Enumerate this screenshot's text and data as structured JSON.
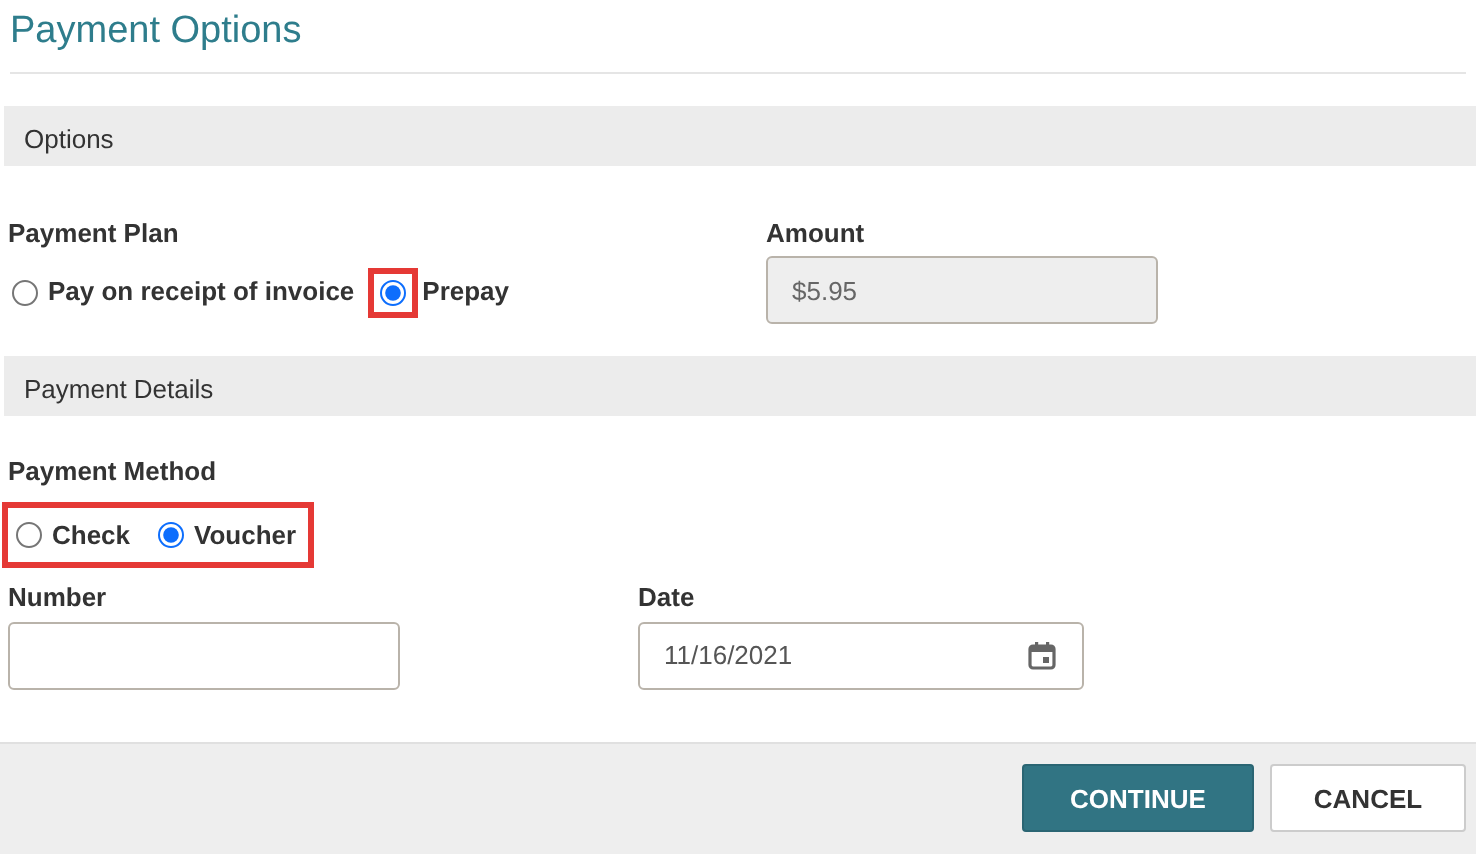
{
  "title": "Payment Options",
  "sections": [
    {
      "heading": "Options"
    },
    {
      "heading": "Payment Details"
    }
  ],
  "payment_plan": {
    "label": "Payment Plan",
    "options": [
      {
        "label": "Pay on receipt of invoice",
        "selected": false,
        "highlighted": false
      },
      {
        "label": "Prepay",
        "selected": true,
        "highlighted": true
      }
    ]
  },
  "amount": {
    "label": "Amount",
    "value": "$5.95",
    "disabled": true
  },
  "payment_method": {
    "label": "Payment Method",
    "highlighted": true,
    "options": [
      {
        "label": "Check",
        "selected": false
      },
      {
        "label": "Voucher",
        "selected": true
      }
    ]
  },
  "number": {
    "label": "Number"
  },
  "date": {
    "label": "Date",
    "value": "11/16/2021"
  },
  "buttons": [
    {
      "label": "CONTINUE",
      "kind": "primary"
    },
    {
      "label": "CANCEL",
      "kind": "secondary"
    }
  ]
}
